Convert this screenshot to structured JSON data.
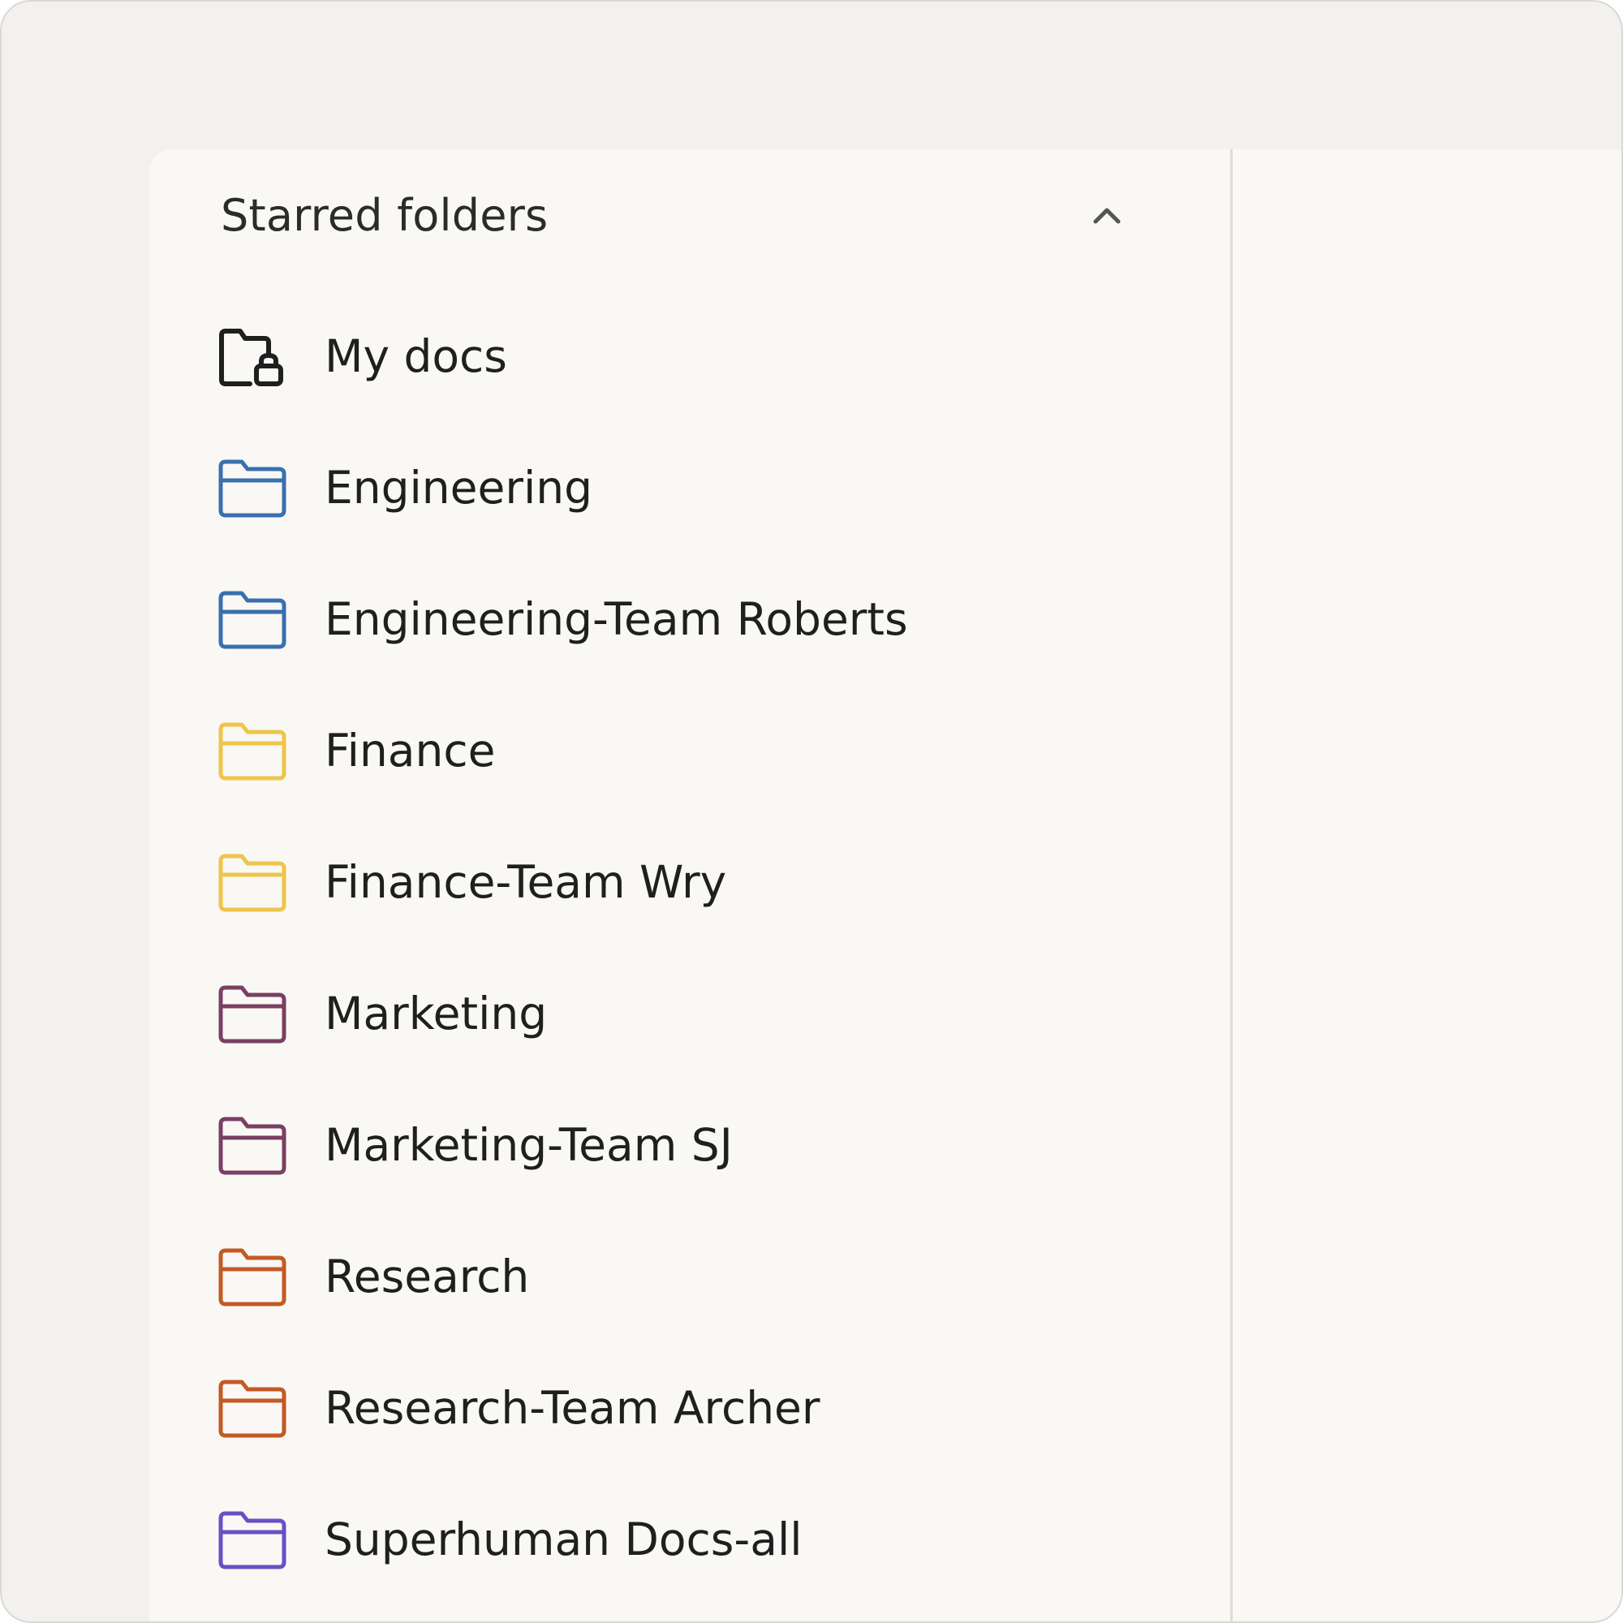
{
  "section": {
    "title": "Starred folders",
    "collapse_icon": "chevron-up-icon"
  },
  "folders": [
    {
      "label": "My docs",
      "icon": "folder-lock-icon",
      "color": "#1f1f1f"
    },
    {
      "label": "Engineering",
      "icon": "folder-icon",
      "color": "#3a6fb0"
    },
    {
      "label": "Engineering-Team Roberts",
      "icon": "folder-icon",
      "color": "#3a6fb0"
    },
    {
      "label": "Finance",
      "icon": "folder-icon",
      "color": "#eec54a"
    },
    {
      "label": "Finance-Team Wry",
      "icon": "folder-icon",
      "color": "#eec54a"
    },
    {
      "label": "Marketing",
      "icon": "folder-icon",
      "color": "#7a3f62"
    },
    {
      "label": "Marketing-Team SJ",
      "icon": "folder-icon",
      "color": "#7a3f62"
    },
    {
      "label": "Research",
      "icon": "folder-icon",
      "color": "#c25a23"
    },
    {
      "label": "Research-Team Archer",
      "icon": "folder-icon",
      "color": "#c25a23"
    },
    {
      "label": "Superhuman Docs-all",
      "icon": "folder-icon",
      "color": "#6a4fc4"
    }
  ]
}
